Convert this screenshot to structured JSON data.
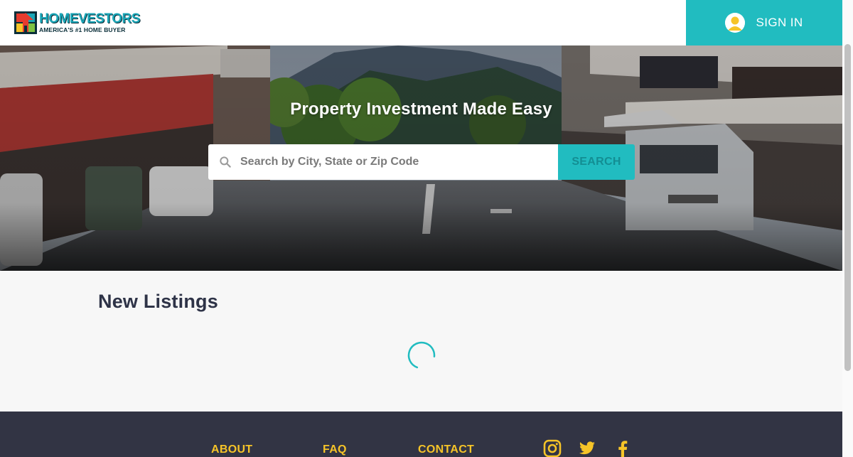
{
  "header": {
    "logo_name": "HOMEVESTORS",
    "logo_tagline": "AMERICA'S #1 HOME BUYER",
    "signin_label": "SIGN IN",
    "signin_icon": "user-avatar-icon"
  },
  "hero": {
    "title": "Property Investment Made Easy",
    "search_placeholder": "Search by City, State or Zip Code",
    "search_value": "",
    "search_button": "SEARCH",
    "search_icon": "search-icon"
  },
  "listings": {
    "title": "New Listings",
    "loading_icon": "spinner-icon"
  },
  "footer": {
    "links": [
      "ABOUT",
      "FAQ",
      "CONTACT"
    ],
    "social": [
      "instagram-icon",
      "twitter-icon",
      "facebook-icon"
    ]
  },
  "colors": {
    "brand_teal": "#21bcc0",
    "footer_bg": "#323444",
    "footer_link": "#f6c428",
    "heading": "#2e3347"
  }
}
